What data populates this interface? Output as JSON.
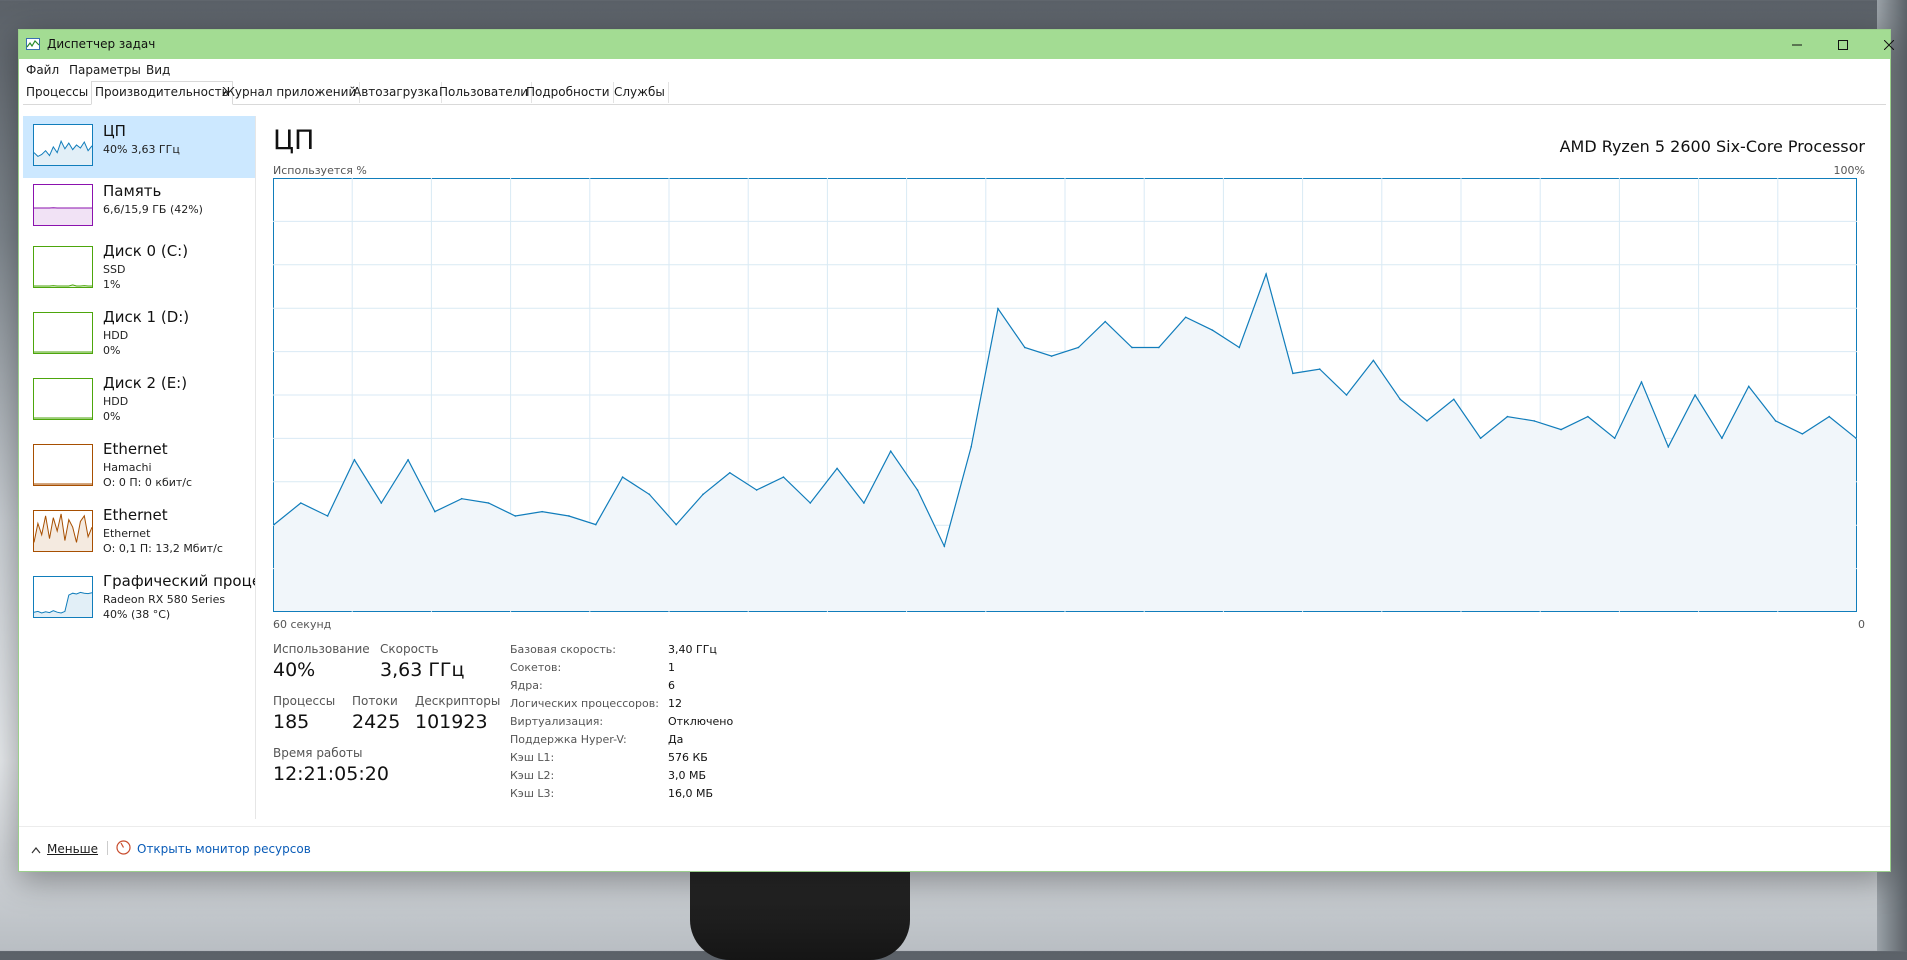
{
  "window": {
    "title": "Диспетчер задач"
  },
  "menu": [
    "Файл",
    "Параметры",
    "Вид"
  ],
  "tabs": [
    "Процессы",
    "Производительность",
    "Журнал приложений",
    "Автозагрузка",
    "Пользователи",
    "Подробности",
    "Службы"
  ],
  "active_tab": "Производительность",
  "sidebar": {
    "items": [
      {
        "title": "ЦП",
        "line1": "40% 3,63 ГГц",
        "line2": "",
        "line3": "",
        "color": "#117dbb"
      },
      {
        "title": "Память",
        "line1": "6,6/15,9 ГБ (42%)",
        "line2": "",
        "line3": "",
        "color": "#8b12ae"
      },
      {
        "title": "Диск 0 (C:)",
        "line1": "SSD",
        "line2": "1%",
        "line3": "",
        "color": "#4da60c"
      },
      {
        "title": "Диск 1 (D:)",
        "line1": "HDD",
        "line2": "0%",
        "line3": "",
        "color": "#4da60c"
      },
      {
        "title": "Диск 2 (E:)",
        "line1": "HDD",
        "line2": "0%",
        "line3": "",
        "color": "#4da60c"
      },
      {
        "title": "Ethernet",
        "line1": "Hamachi",
        "line2": "О: 0 П: 0 кбит/с",
        "line3": "",
        "color": "#a74f01"
      },
      {
        "title": "Ethernet",
        "line1": "Ethernet",
        "line2": "О: 0,1 П: 13,2 Мбит/с",
        "line3": "",
        "color": "#a74f01"
      },
      {
        "title": "Графический процес",
        "line1": "Radeon RX 580 Series",
        "line2": "40% (38 °C)",
        "line3": "",
        "color": "#117dbb"
      }
    ]
  },
  "main": {
    "title": "ЦП",
    "processor": "AMD Ryzen 5 2600 Six-Core Processor",
    "usage_label": "Используется %",
    "max_label": "100%",
    "time_label": "60 секунд",
    "min_label": "0",
    "stats": {
      "usage_label": "Использование",
      "usage_value": "40%",
      "speed_label": "Скорость",
      "speed_value": "3,63 ГГц",
      "processes_label": "Процессы",
      "processes_value": "185",
      "threads_label": "Потоки",
      "threads_value": "2425",
      "handles_label": "Дескрипторы",
      "handles_value": "101923",
      "uptime_label": "Время работы",
      "uptime_value": "12:21:05:20"
    },
    "info": [
      {
        "k": "Базовая скорость:",
        "v": "3,40 ГГц"
      },
      {
        "k": "Сокетов:",
        "v": "1"
      },
      {
        "k": "Ядра:",
        "v": "6"
      },
      {
        "k": "Логических процессоров:",
        "v": "12"
      },
      {
        "k": "Виртуализация:",
        "v": "Отключено"
      },
      {
        "k": "Поддержка Hyper-V:",
        "v": "Да"
      },
      {
        "k": "Кэш L1:",
        "v": "576 КБ"
      },
      {
        "k": "Кэш L2:",
        "v": "3,0 МБ"
      },
      {
        "k": "Кэш L3:",
        "v": "16,0 МБ"
      }
    ]
  },
  "footer": {
    "less": "Меньше",
    "monitor": "Открыть монитор ресурсов"
  },
  "chart_data": {
    "type": "area",
    "title": "ЦП",
    "ylabel": "Используется %",
    "xlabel": "60 секунд",
    "ylim": [
      0,
      100
    ],
    "grid": true,
    "color": "#117dbb",
    "values": [
      20,
      25,
      22,
      35,
      25,
      35,
      23,
      26,
      25,
      22,
      23,
      22,
      20,
      31,
      27,
      20,
      27,
      32,
      28,
      31,
      25,
      33,
      25,
      37,
      28,
      15,
      38,
      70,
      61,
      59,
      61,
      67,
      61,
      61,
      68,
      65,
      61,
      78,
      55,
      56,
      50,
      58,
      49,
      44,
      49,
      40,
      45,
      44,
      42,
      45,
      40,
      53,
      38,
      50,
      40,
      52,
      44,
      41,
      45,
      40
    ]
  },
  "sidebar_sparklines": {
    "cpu": [
      30,
      20,
      25,
      35,
      22,
      45,
      30,
      60,
      40,
      55,
      38,
      50,
      42,
      58,
      35,
      48
    ],
    "memory": [
      42,
      42,
      42,
      42,
      42,
      43,
      42,
      42,
      42,
      42,
      42,
      42,
      42,
      42,
      42,
      42
    ],
    "disk0": [
      0,
      0,
      0,
      0,
      0,
      1,
      0,
      0,
      0,
      0,
      3,
      0,
      0,
      1,
      0,
      0
    ],
    "disk1": [
      0,
      0,
      0,
      0,
      0,
      0,
      0,
      0,
      0,
      0,
      0,
      0,
      0,
      0,
      0,
      0
    ],
    "disk2": [
      0,
      0,
      0,
      0,
      0,
      0,
      0,
      0,
      0,
      0,
      0,
      0,
      0,
      0,
      0,
      0
    ],
    "hamachi": [
      0,
      0,
      0,
      0,
      0,
      0,
      0,
      0,
      0,
      0,
      0,
      0,
      0,
      0,
      0,
      0
    ],
    "ethernet": [
      20,
      70,
      40,
      90,
      30,
      85,
      50,
      95,
      25,
      80,
      60,
      20,
      75,
      90,
      35,
      60
    ],
    "gpu": [
      10,
      12,
      8,
      11,
      9,
      14,
      10,
      8,
      12,
      55,
      60,
      58,
      62,
      60,
      59,
      61
    ]
  }
}
